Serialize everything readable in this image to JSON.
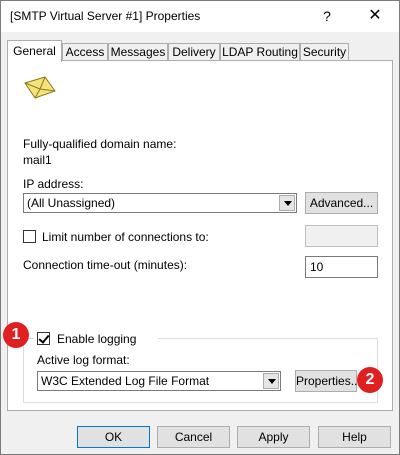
{
  "window": {
    "title": "[SMTP Virtual Server #1] Properties",
    "help_glyph": "?",
    "close_glyph": "✕"
  },
  "tabs": [
    {
      "label": "General",
      "active": true
    },
    {
      "label": "Access",
      "active": false
    },
    {
      "label": "Messages",
      "active": false
    },
    {
      "label": "Delivery",
      "active": false
    },
    {
      "label": "LDAP Routing",
      "active": false
    },
    {
      "label": "Security",
      "active": false
    }
  ],
  "general": {
    "icon": "mail-envelope-icon",
    "fqdn_label": "Fully-qualified domain name:",
    "fqdn_value": "mail1",
    "ip_label": "IP address:",
    "ip_value": "(All Unassigned)",
    "advanced_label": "Advanced...",
    "limit_label": "Limit number of connections to:",
    "limit_checked": false,
    "limit_value": "",
    "timeout_label": "Connection time-out (minutes):",
    "timeout_value": "10",
    "logging_label": "Enable logging",
    "logging_checked": true,
    "log_format_label": "Active log format:",
    "log_format_value": "W3C Extended Log File Format",
    "properties_label": "Properties..."
  },
  "annotations": [
    {
      "label": "1"
    },
    {
      "label": "2"
    }
  ],
  "footer": {
    "ok_label": "OK",
    "cancel_label": "Cancel",
    "apply_label": "Apply",
    "help_label": "Help"
  },
  "colors": {
    "badge": "#e02020",
    "default_button_border": "#0078d7"
  }
}
